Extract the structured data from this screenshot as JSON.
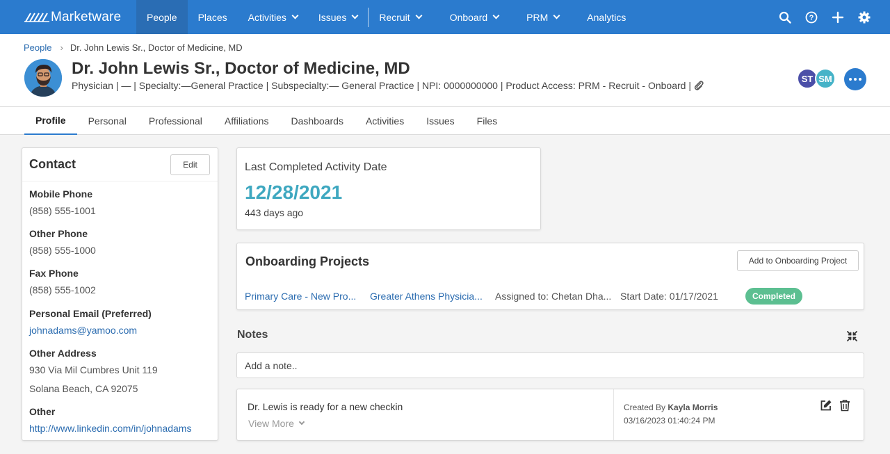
{
  "nav": {
    "logo": "Marketware",
    "items": [
      {
        "label": "People",
        "active": true,
        "dropdown": false
      },
      {
        "label": "Places",
        "active": false,
        "dropdown": false
      },
      {
        "label": "Activities",
        "active": false,
        "dropdown": true
      },
      {
        "label": "Issues",
        "active": false,
        "dropdown": true
      },
      {
        "label": "Recruit",
        "active": false,
        "dropdown": true
      },
      {
        "label": "Onboard",
        "active": false,
        "dropdown": true
      },
      {
        "label": "PRM",
        "active": false,
        "dropdown": true
      },
      {
        "label": "Analytics",
        "active": false,
        "dropdown": false
      }
    ],
    "icons": [
      "search-icon",
      "help-icon",
      "plus-icon",
      "gear-icon"
    ],
    "colors": {
      "bar": "#2b7bce",
      "active": "#2a6db4"
    }
  },
  "breadcrumb": {
    "root": "People",
    "current": "Dr. John Lewis Sr., Doctor of Medicine, MD"
  },
  "profile": {
    "name": "Dr. John Lewis Sr., Doctor of Medicine, MD",
    "subtitle": "Physician | — | Specialty:—General Practice | Subspecialty:— General Practice | NPI: 0000000000 | Product Access: PRM - Recruit - Onboard |",
    "assignees": [
      {
        "initials": "ST",
        "color": "#4b4fa8"
      },
      {
        "initials": "SM",
        "color": "#46b3c8"
      }
    ]
  },
  "tabs": [
    {
      "label": "Profile",
      "active": true
    },
    {
      "label": "Personal",
      "active": false
    },
    {
      "label": "Professional",
      "active": false
    },
    {
      "label": "Affiliations",
      "active": false
    },
    {
      "label": "Dashboards",
      "active": false
    },
    {
      "label": "Activities",
      "active": false
    },
    {
      "label": "Issues",
      "active": false
    },
    {
      "label": "Files",
      "active": false
    }
  ],
  "contact": {
    "title": "Contact",
    "edit_label": "Edit",
    "mobile_label": "Mobile Phone",
    "mobile_value": "(858) 555-1001",
    "other_phone_label": "Other Phone",
    "other_phone_value": "(858) 555-1000",
    "fax_label": "Fax Phone",
    "fax_value": "(858) 555-1002",
    "email_label": "Personal Email (Preferred)",
    "email_value": "johnadams@yamoo.com",
    "address_label": "Other Address",
    "address_line1": "930 Via Mil Cumbres Unit 119",
    "address_line2": "Solana Beach, CA 92075",
    "other_label": "Other",
    "other_value": "http://www.linkedin.com/in/johnadams"
  },
  "activity": {
    "label": "Last Completed Activity Date",
    "date": "12/28/2021",
    "ago": "443 days ago"
  },
  "onboarding": {
    "title": "Onboarding Projects",
    "add_label": "Add to Onboarding Project",
    "row": {
      "project": "Primary Care - New Pro...",
      "org": "Greater Athens Physicia...",
      "assigned": "Assigned to: Chetan Dha...",
      "start": "Start Date: 01/17/2021",
      "status": "Completed"
    }
  },
  "notes": {
    "title": "Notes",
    "placeholder": "Add a note..",
    "items": [
      {
        "text": "Dr. Lewis is ready for a new checkin",
        "view_more": "View More",
        "created_by_label": "Created By",
        "author": "Kayla Morris",
        "timestamp": "03/16/2023 01:40:24 PM"
      }
    ]
  }
}
